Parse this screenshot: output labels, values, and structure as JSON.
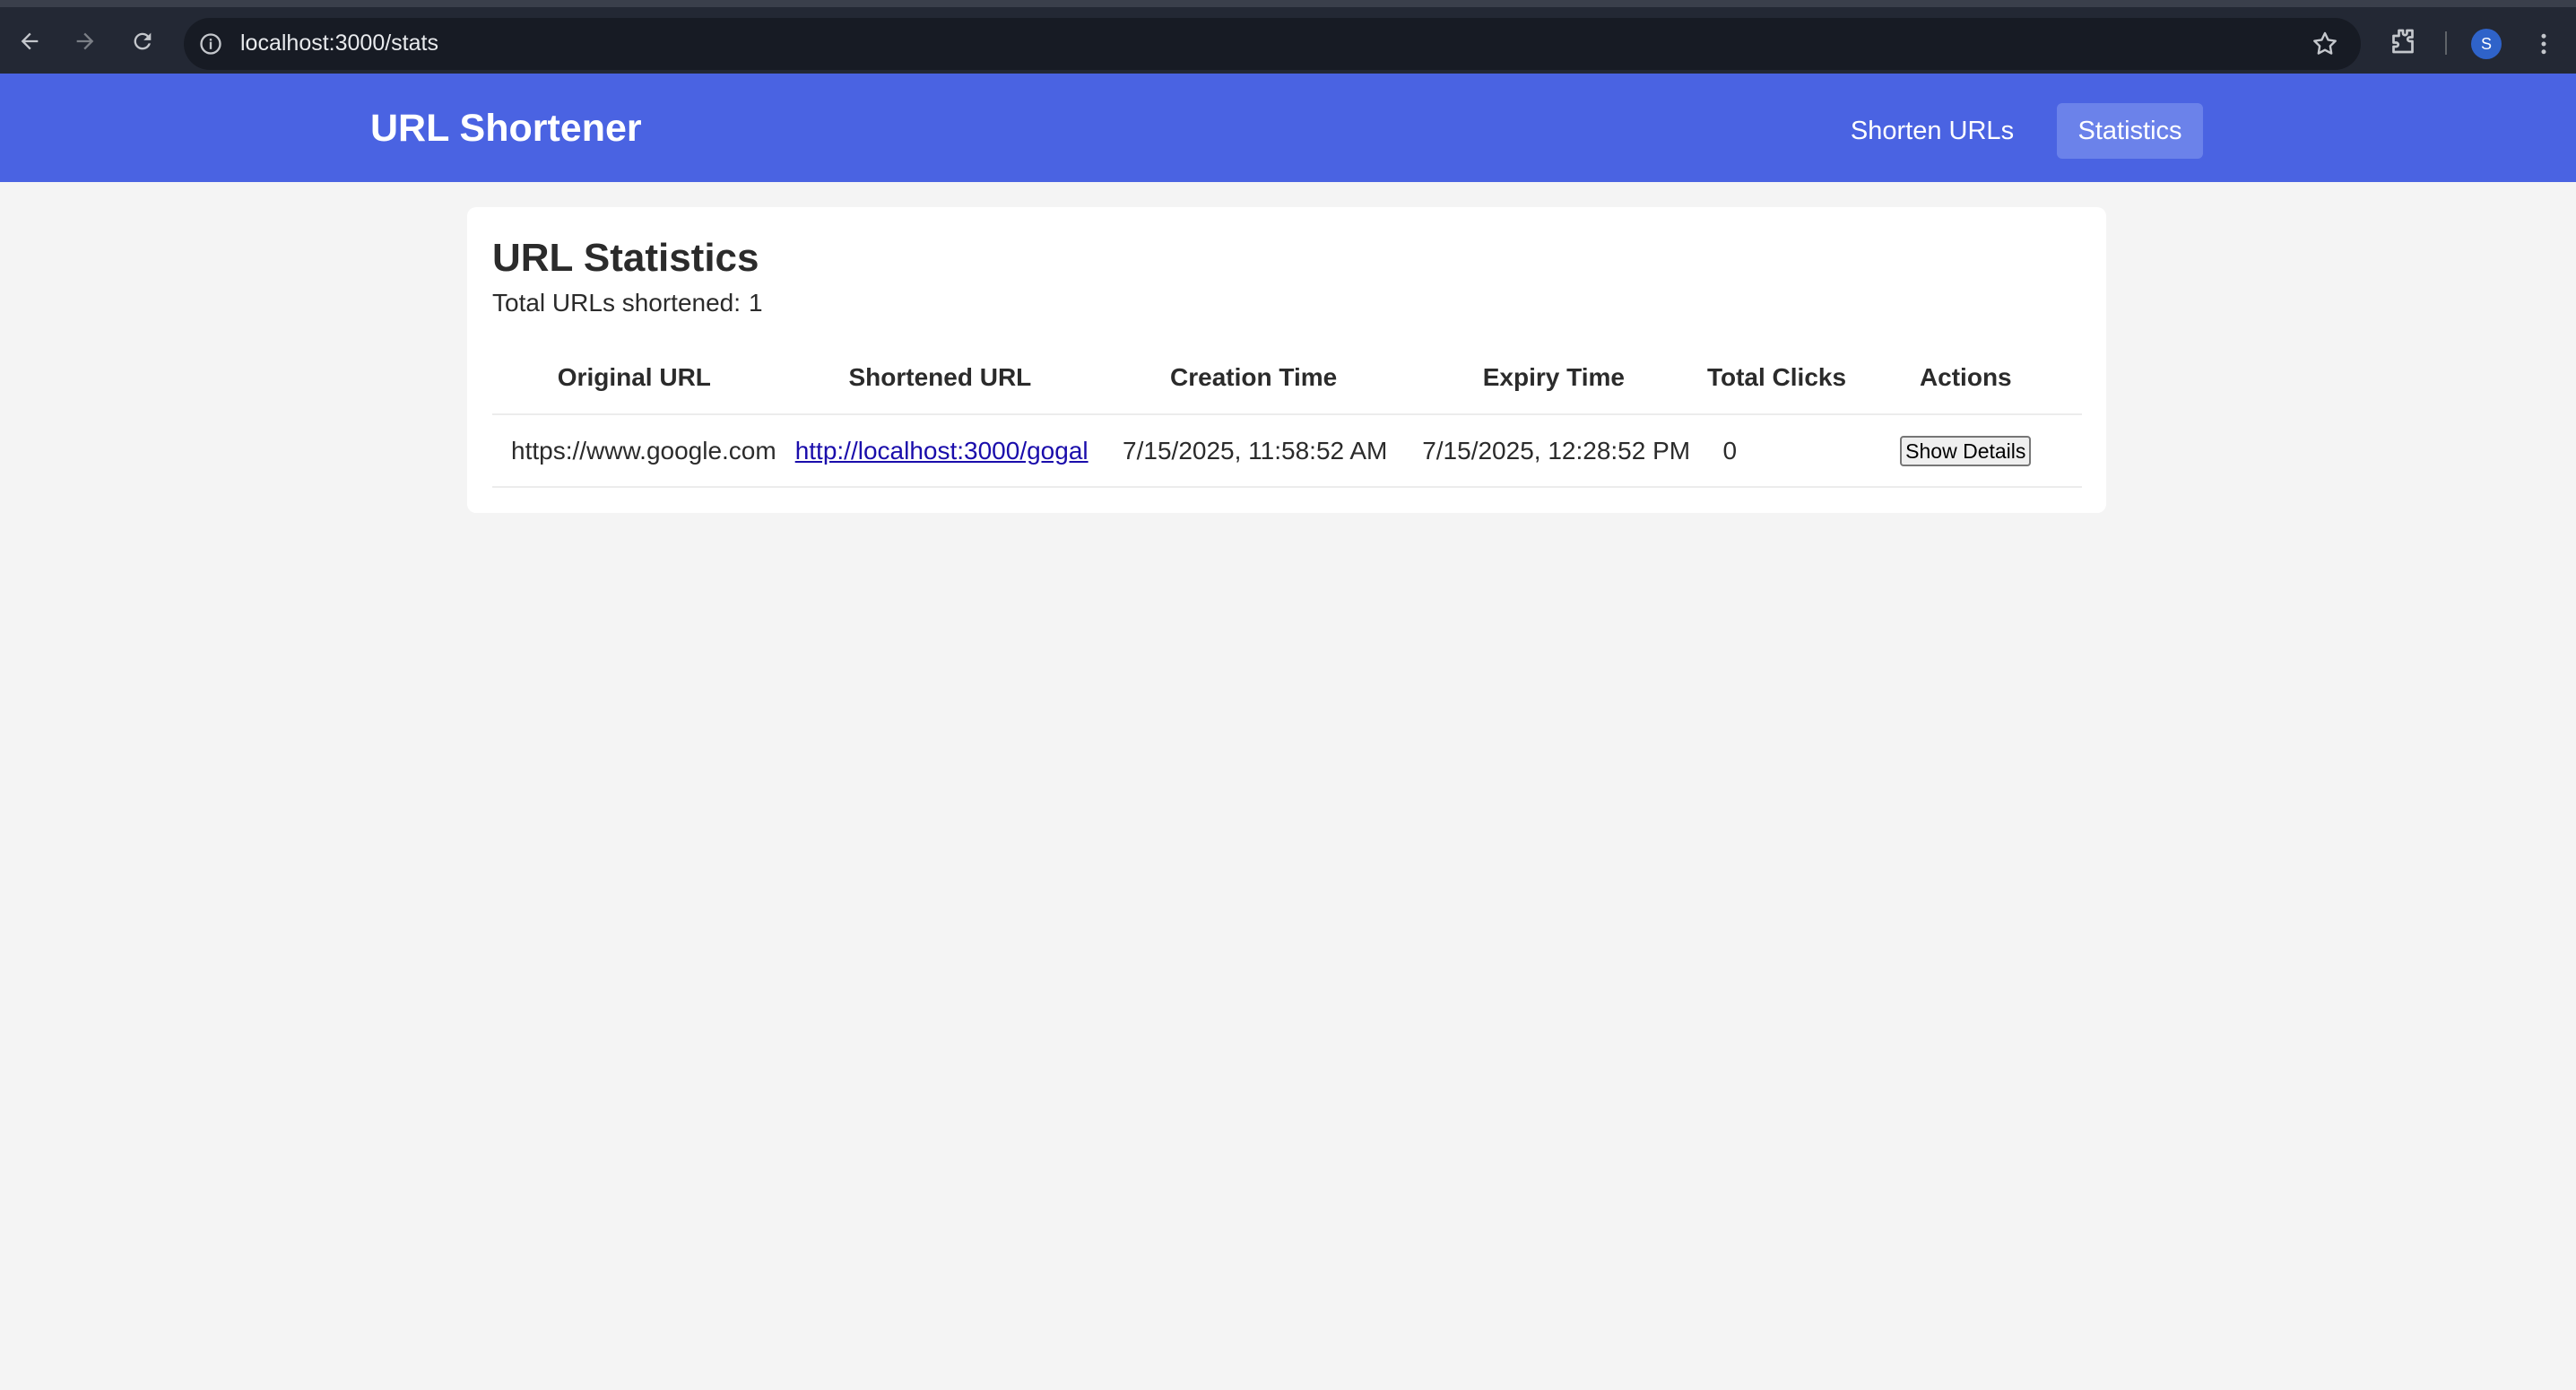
{
  "browser": {
    "url": "localhost:3000/stats",
    "profile_initial": "S"
  },
  "header": {
    "title": "URL Shortener",
    "nav": [
      {
        "label": "Shorten URLs",
        "active": false
      },
      {
        "label": "Statistics",
        "active": true
      }
    ]
  },
  "stats": {
    "title": "URL Statistics",
    "summary_label": "Total URLs shortened:",
    "summary_count": "1",
    "columns": [
      "Original URL",
      "Shortened URL",
      "Creation Time",
      "Expiry Time",
      "Total Clicks",
      "Actions"
    ],
    "rows": [
      {
        "original_url": "https://www.google.com",
        "short_url": "http://localhost:3000/gogal",
        "created": "7/15/2025, 11:58:52 AM",
        "expires": "7/15/2025, 12:28:52 PM",
        "clicks": "0",
        "action_label": "Show Details"
      }
    ]
  },
  "colors": {
    "header_bg": "#4a63e2",
    "active_nav_bg": "#6b82ea",
    "page_bg": "#f4f4f4",
    "link": "#1a0dab"
  }
}
